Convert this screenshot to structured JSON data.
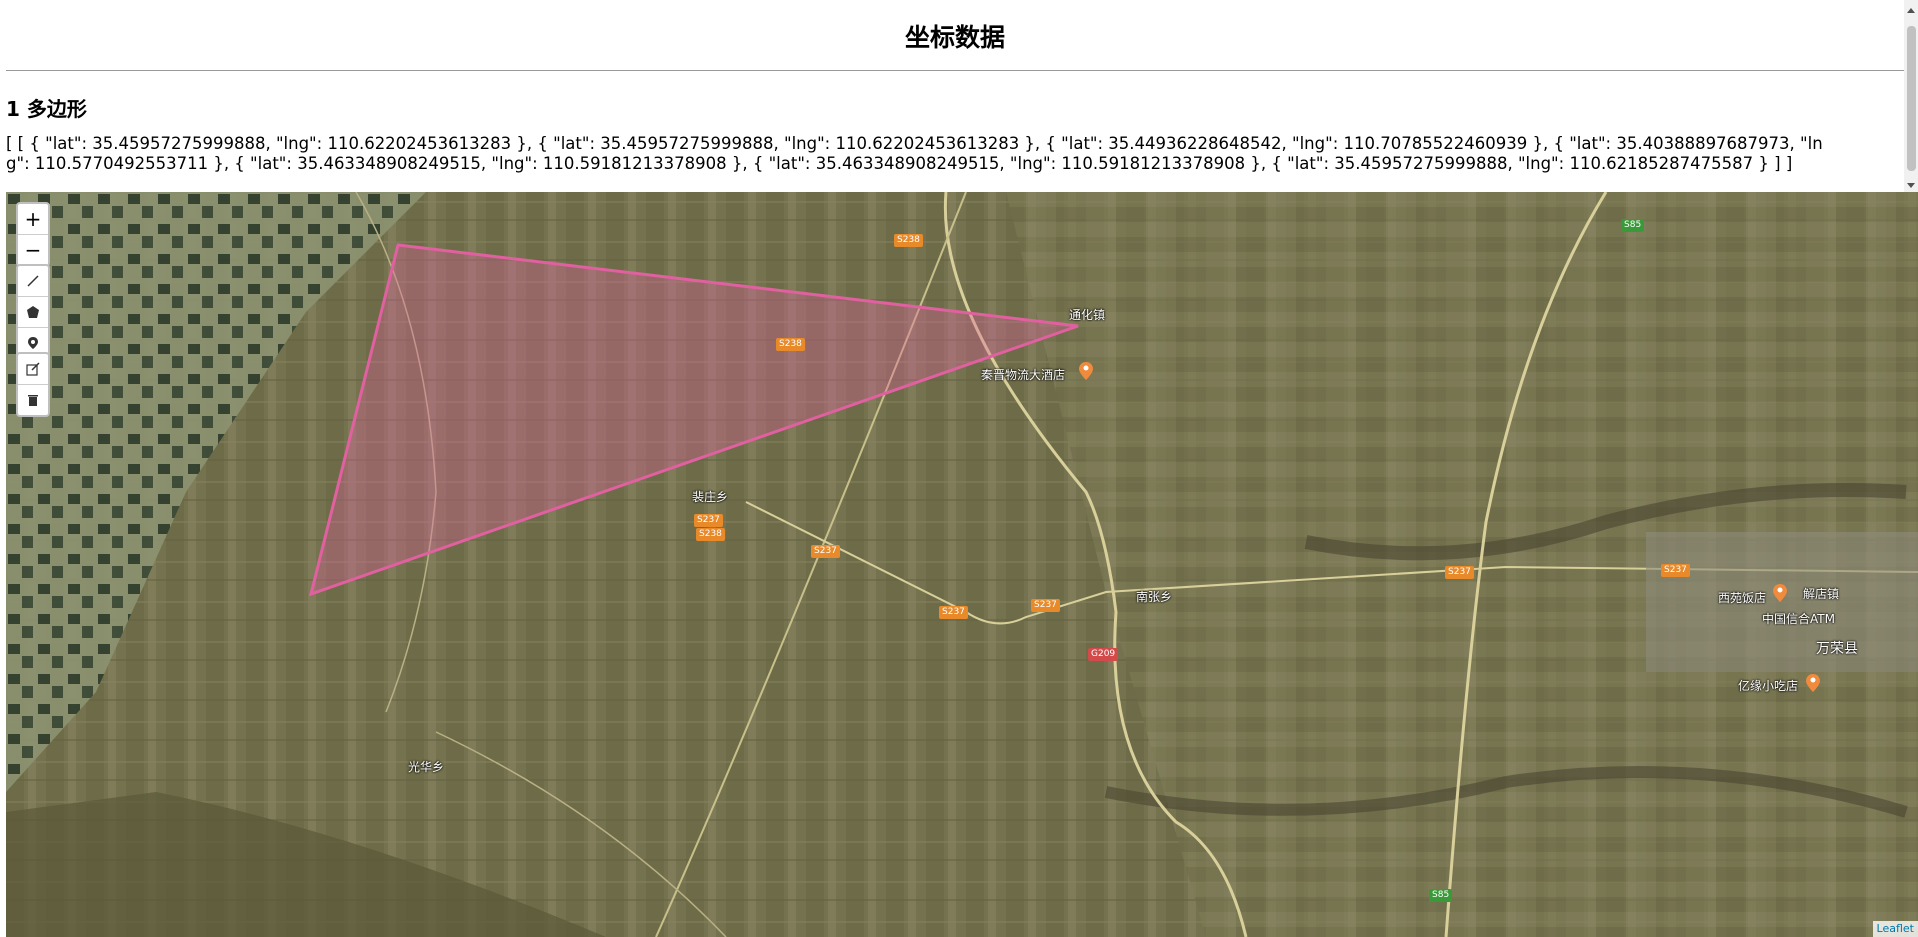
{
  "header": {
    "title": "坐标数据",
    "section_title": "1 多边形",
    "coordinates_text": "[ [ { \"lat\": 35.45957275999888, \"lng\": 110.62202453613283 }, { \"lat\": 35.45957275999888, \"lng\": 110.62202453613283 }, { \"lat\": 35.44936228648542, \"lng\": 110.70785522460939 }, { \"lat\": 35.40388897687973, \"lng\": 110.5770492553711 }, { \"lat\": 35.463348908249515, \"lng\": 110.59181213378908 }, { \"lat\": 35.463348908249515, \"lng\": 110.59181213378908 }, { \"lat\": 35.45957275999888, \"lng\": 110.62185287475587 } ] ]"
  },
  "map": {
    "controls": {
      "zoom_in": "+",
      "zoom_out": "−"
    },
    "place_labels": {
      "tonghua": "通化镇",
      "hotel": "秦晋物流大酒店",
      "peizhuang": "裴庄乡",
      "nanzhang": "南张乡",
      "guanghua": "光华乡",
      "xiyuan_hotel": "西苑饭店",
      "jiedian": "解店镇",
      "atm": "中国信合ATM",
      "wanrong": "万荣县",
      "snack": "亿缘小吃店"
    },
    "road_labels": {
      "s238a": "S238",
      "s238b": "S238",
      "s238c": "S238",
      "s237a": "S237",
      "s237b": "S237",
      "s237c": "S237",
      "s237d": "S237",
      "s237e": "S237",
      "s237f": "S237",
      "s85a": "S85",
      "s85b": "S85",
      "g209": "G209"
    },
    "attribution": "Leaflet",
    "polygon_color": "#e060a0"
  }
}
